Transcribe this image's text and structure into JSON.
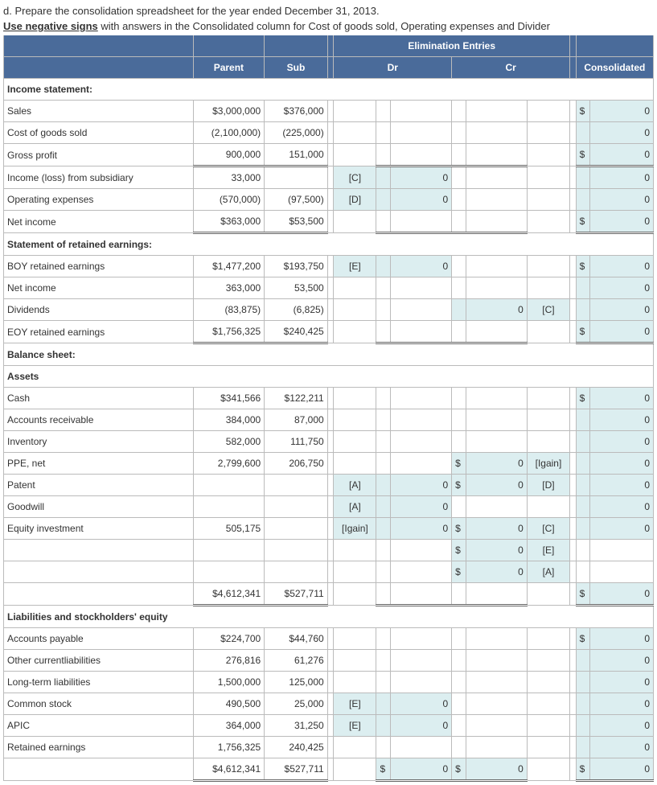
{
  "instr1_a": "d. Prepare the consolidation spreadsheet for the year ended December 31, 2013.",
  "instr2_bold": "Use negative signs",
  "instr2_b": " with answers in the Consolidated column for Cost of goods sold, Operating expenses and Divider",
  "head": {
    "parent": "Parent",
    "sub": "Sub",
    "elim": "Elimination Entries",
    "dr": "Dr",
    "cr": "Cr",
    "cons": "Consolidated"
  },
  "sec": {
    "inc": "Income statement:",
    "re": "Statement of retained earnings:",
    "bs": "Balance sheet:",
    "assets": "Assets",
    "liab": "Liabilities and stockholders' equity"
  },
  "rows": {
    "sales": {
      "l": "Sales",
      "p": "$3,000,000",
      "s": "$376,000",
      "cp": "$",
      "cv": "0"
    },
    "cogs": {
      "l": "Cost of goods sold",
      "p": "(2,100,000)",
      "s": "(225,000)",
      "cv": "0"
    },
    "gp": {
      "l": "Gross profit",
      "p": "900,000",
      "s": "151,000",
      "cp": "$",
      "cv": "0"
    },
    "incsub": {
      "l": "Income (loss) from subsidiary",
      "p": "33,000",
      "dc": "[C]",
      "dv": "0",
      "cv": "0"
    },
    "opex": {
      "l": "Operating expenses",
      "p": "(570,000)",
      "s": "(97,500)",
      "dc": "[D]",
      "dv": "0",
      "cv": "0"
    },
    "ni": {
      "l": "Net income",
      "p": "$363,000",
      "s": "$53,500",
      "cp": "$",
      "cv": "0"
    },
    "boy": {
      "l": "BOY retained earnings",
      "p": "$1,477,200",
      "s": "$193,750",
      "dc": "[E]",
      "dv": "0",
      "cp": "$",
      "cv": "0"
    },
    "ni2": {
      "l": "Net income",
      "p": "363,000",
      "s": "53,500",
      "cv": "0"
    },
    "div": {
      "l": "Dividends",
      "p": "(83,875)",
      "s": "(6,825)",
      "crv": "0",
      "cc": "[C]",
      "cv": "0"
    },
    "eoy": {
      "l": "EOY retained earnings",
      "p": "$1,756,325",
      "s": "$240,425",
      "cp": "$",
      "cv": "0"
    },
    "cash": {
      "l": "Cash",
      "p": "$341,566",
      "s": "$122,211",
      "cp": "$",
      "cv": "0"
    },
    "ar": {
      "l": "Accounts receivable",
      "p": "384,000",
      "s": "87,000",
      "cv": "0"
    },
    "inv": {
      "l": "Inventory",
      "p": "582,000",
      "s": "111,750",
      "cv": "0"
    },
    "ppe": {
      "l": "PPE, net",
      "p": "2,799,600",
      "s": "206,750",
      "crp": "$",
      "crv": "0",
      "cc": "[Igain]",
      "cv": "0"
    },
    "pat": {
      "l": "Patent",
      "dc": "[A]",
      "dv": "0",
      "crp": "$",
      "crv": "0",
      "cc": "[D]",
      "cv": "0"
    },
    "gw": {
      "l": "Goodwill",
      "dc": "[A]",
      "dv": "0",
      "cv": "0"
    },
    "eq": {
      "l": "Equity investment",
      "p": "505,175",
      "dc": "[Igain]",
      "dv": "0",
      "crp": "$",
      "crv": "0",
      "cc": "[C]",
      "cv": "0"
    },
    "eq2": {
      "crp": "$",
      "crv": "0",
      "cc": "[E]"
    },
    "eq3": {
      "crp": "$",
      "crv": "0",
      "cc": "[A]"
    },
    "atot": {
      "p": "$4,612,341",
      "s": "$527,711",
      "cp": "$",
      "cv": "0"
    },
    "ap": {
      "l": "Accounts payable",
      "p": "$224,700",
      "s": "$44,760",
      "cp": "$",
      "cv": "0"
    },
    "ocl": {
      "l": "Other currentliabilities",
      "p": "276,816",
      "s": "61,276",
      "cv": "0"
    },
    "ltl": {
      "l": "Long-term liabilities",
      "p": "1,500,000",
      "s": "125,000",
      "cv": "0"
    },
    "cs": {
      "l": "Common stock",
      "p": "490,500",
      "s": "25,000",
      "dc": "[E]",
      "dv": "0",
      "cv": "0"
    },
    "apic": {
      "l": "APIC",
      "p": "364,000",
      "s": "31,250",
      "dc": "[E]",
      "dv": "0",
      "cv": "0"
    },
    "re2": {
      "l": "Retained earnings",
      "p": "1,756,325",
      "s": "240,425",
      "cv": "0"
    },
    "ltot": {
      "p": "$4,612,341",
      "s": "$527,711",
      "dp": "$",
      "dv": "0",
      "crp": "$",
      "crv": "0",
      "cp": "$",
      "cv": "0"
    }
  }
}
